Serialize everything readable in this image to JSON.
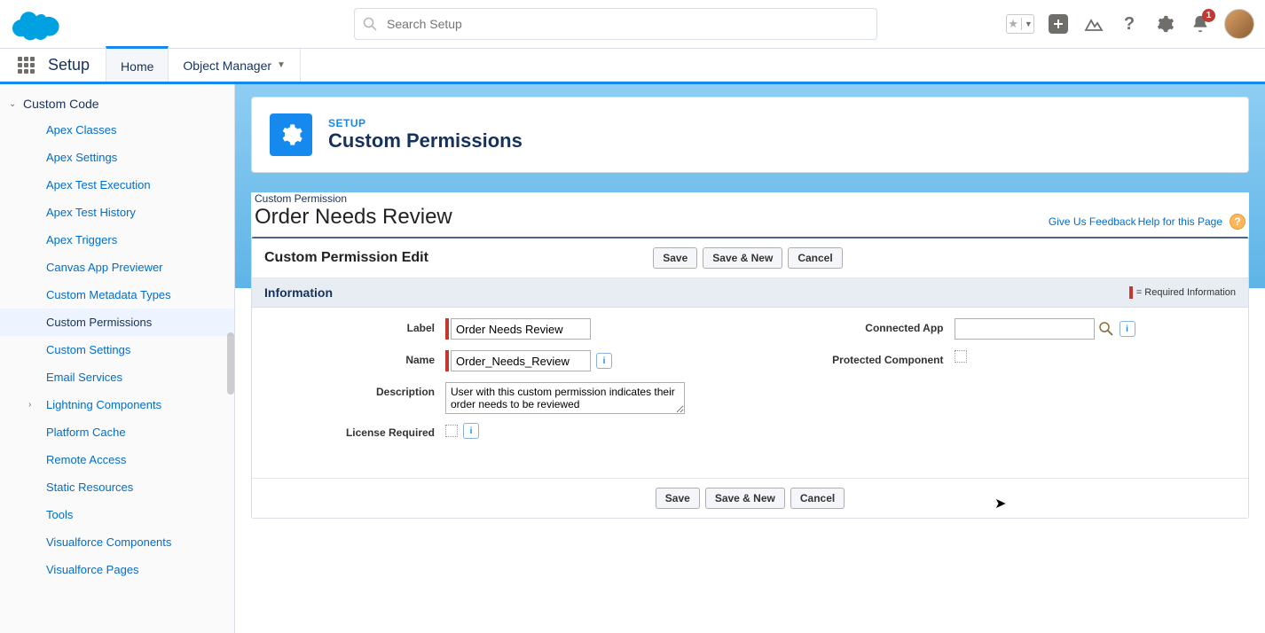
{
  "header": {
    "search_placeholder": "Search Setup",
    "notification_count": "1"
  },
  "nav": {
    "app_name": "Setup",
    "tab_home": "Home",
    "tab_object_manager": "Object Manager"
  },
  "sidebar": {
    "section": "Custom Code",
    "items": [
      "Apex Classes",
      "Apex Settings",
      "Apex Test Execution",
      "Apex Test History",
      "Apex Triggers",
      "Canvas App Previewer",
      "Custom Metadata Types",
      "Custom Permissions",
      "Custom Settings",
      "Email Services",
      "Lightning Components",
      "Platform Cache",
      "Remote Access",
      "Static Resources",
      "Tools",
      "Visualforce Components",
      "Visualforce Pages"
    ]
  },
  "page_header": {
    "eyebrow": "SETUP",
    "title": "Custom Permissions"
  },
  "content": {
    "sub_label": "Custom Permission",
    "record_title": "Order Needs Review",
    "feedback_link": "Give Us Feedback",
    "help_link": "Help for this Page",
    "panel_title": "Custom Permission Edit",
    "info_header": "Information",
    "required_legend": "= Required Information",
    "buttons": {
      "save": "Save",
      "save_new": "Save & New",
      "cancel": "Cancel"
    }
  },
  "form": {
    "label_lbl": "Label",
    "label_val": "Order Needs Review",
    "name_lbl": "Name",
    "name_val": "Order_Needs_Review",
    "desc_lbl": "Description",
    "desc_val": "User with this custom permission indicates their order needs to be reviewed",
    "license_lbl": "License Required",
    "conn_app_lbl": "Connected App",
    "conn_app_val": "",
    "protected_lbl": "Protected Component"
  }
}
